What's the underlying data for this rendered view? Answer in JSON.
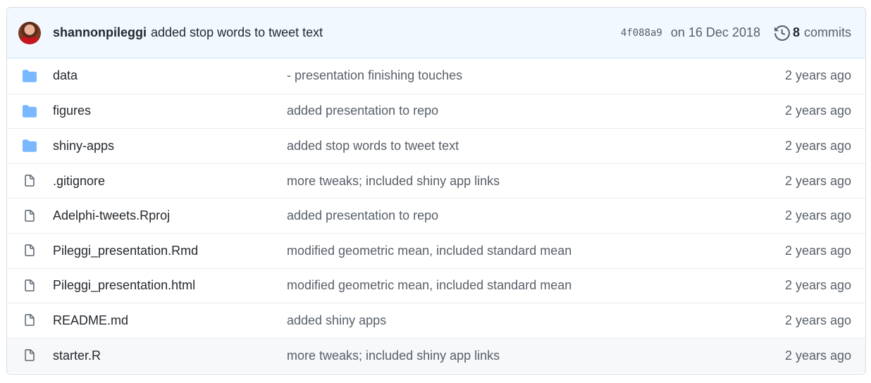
{
  "header": {
    "author": "shannonpileggi",
    "message": "added stop words to tweet text",
    "sha": "4f088a9",
    "date": "on 16 Dec 2018",
    "commit_count": "8",
    "commits_label": "commits",
    "history_icon": "history-icon",
    "avatar_icon": "avatar"
  },
  "colors": {
    "folder": "#79b8ff",
    "file": "#6a737d",
    "header_bg": "#f1f8ff",
    "muted": "#586069"
  },
  "files": [
    {
      "type": "folder",
      "name": "data",
      "message": "- presentation finishing touches",
      "age": "2 years ago"
    },
    {
      "type": "folder",
      "name": "figures",
      "message": "added presentation to repo",
      "age": "2 years ago"
    },
    {
      "type": "folder",
      "name": "shiny-apps",
      "message": "added stop words to tweet text",
      "age": "2 years ago"
    },
    {
      "type": "file",
      "name": ".gitignore",
      "message": "more tweaks; included shiny app links",
      "age": "2 years ago"
    },
    {
      "type": "file",
      "name": "Adelphi-tweets.Rproj",
      "message": "added presentation to repo",
      "age": "2 years ago"
    },
    {
      "type": "file",
      "name": "Pileggi_presentation.Rmd",
      "message": "modified geometric mean, included standard mean",
      "age": "2 years ago"
    },
    {
      "type": "file",
      "name": "Pileggi_presentation.html",
      "message": "modified geometric mean, included standard mean",
      "age": "2 years ago"
    },
    {
      "type": "file",
      "name": "README.md",
      "message": "added shiny apps",
      "age": "2 years ago"
    },
    {
      "type": "file",
      "name": "starter.R",
      "message": "more tweaks; included shiny app links",
      "age": "2 years ago"
    }
  ]
}
